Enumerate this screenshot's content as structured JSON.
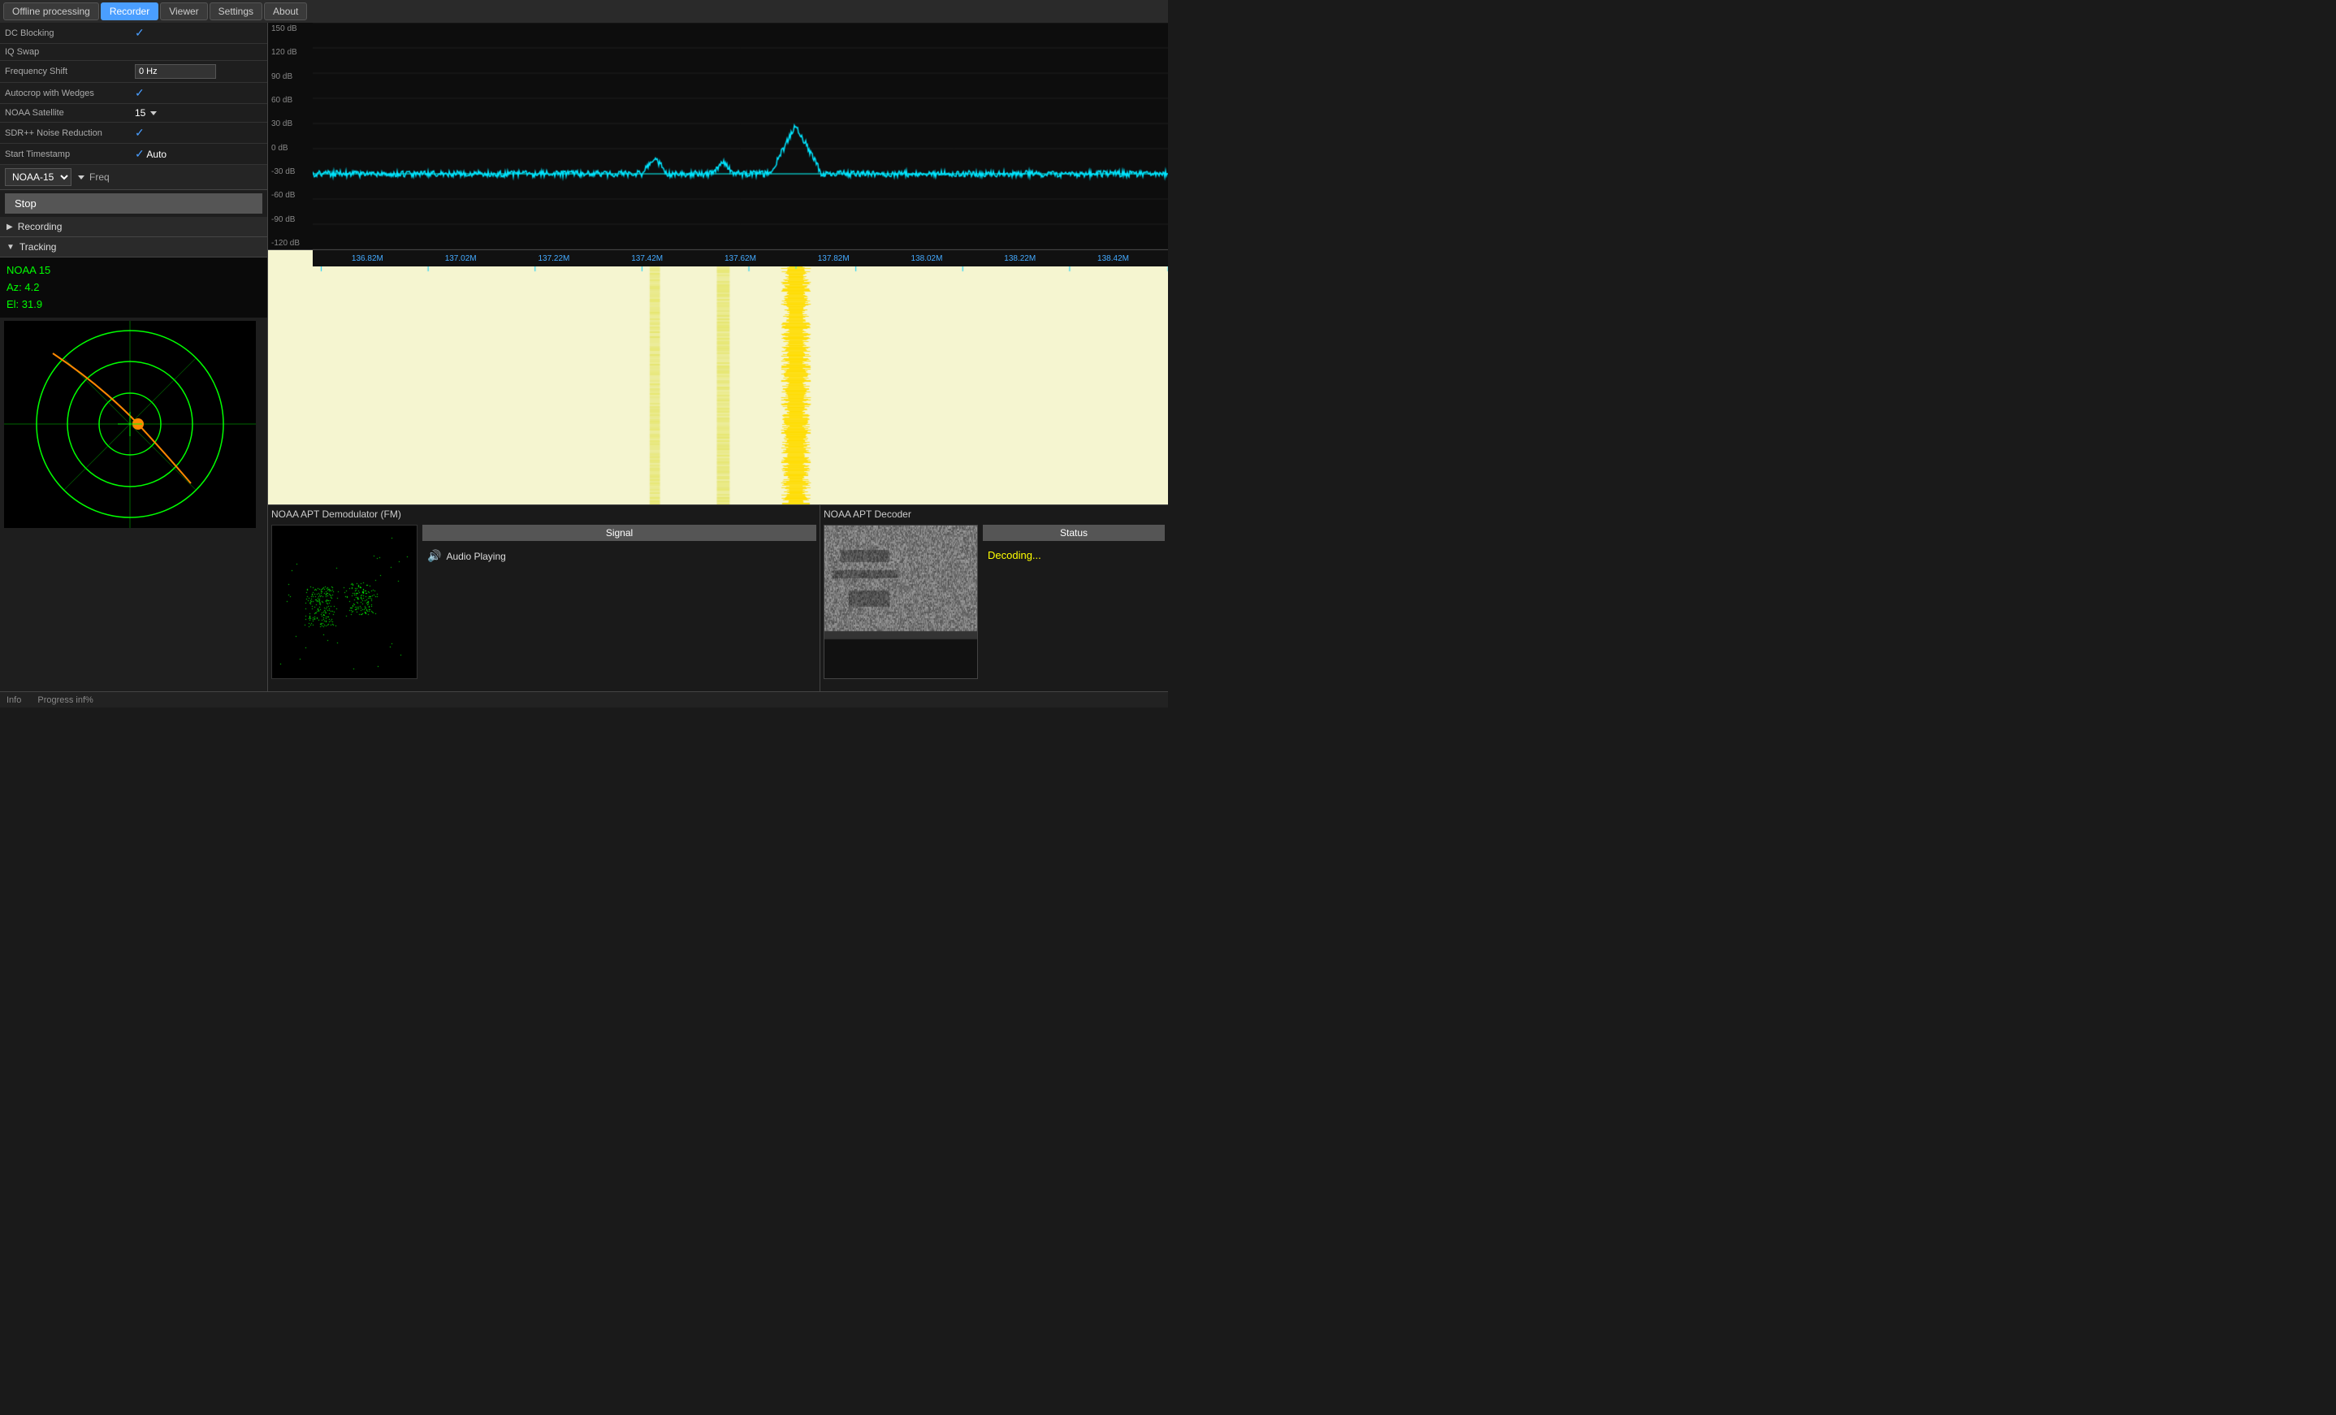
{
  "nav": {
    "tabs": [
      {
        "id": "offline",
        "label": "Offline processing",
        "active": false
      },
      {
        "id": "recorder",
        "label": "Recorder",
        "active": true
      },
      {
        "id": "viewer",
        "label": "Viewer",
        "active": false
      },
      {
        "id": "settings",
        "label": "Settings",
        "active": false
      },
      {
        "id": "about",
        "label": "About",
        "active": false
      }
    ]
  },
  "settings": {
    "rows": [
      {
        "label": "DC Blocking",
        "value": "✓",
        "type": "check"
      },
      {
        "label": "IQ Swap",
        "value": "",
        "type": "check-empty"
      },
      {
        "label": "Frequency Shift",
        "value": "0 Hz",
        "type": "input"
      },
      {
        "label": "Autocrop with Wedges",
        "value": "✓",
        "type": "check"
      },
      {
        "label": "NOAA Satellite",
        "value": "15",
        "type": "dropdown"
      },
      {
        "label": "SDR++ Noise Reduction",
        "value": "✓",
        "type": "check"
      },
      {
        "label": "Start Timestamp",
        "value": "Auto",
        "type": "check-text"
      }
    ]
  },
  "satellite_selector": {
    "name": "NOAA-15",
    "freq_label": "Freq"
  },
  "controls": {
    "stop_label": "Stop",
    "recording_label": "Recording",
    "tracking_label": "Tracking"
  },
  "tracking_info": {
    "name": "NOAA 15",
    "az_label": "Az:",
    "az_value": "4.2",
    "el_label": "El:",
    "el_value": "31.9"
  },
  "spectrum": {
    "db_labels": [
      "150 dB",
      "120 dB",
      "90 dB",
      "60 dB",
      "30 dB",
      "0 dB",
      "-30 dB",
      "-60 dB",
      "-90 dB",
      "-120 dB"
    ],
    "freq_labels": [
      "136.82M",
      "137.02M",
      "137.22M",
      "137.42M",
      "137.62M",
      "137.82M",
      "138.02M",
      "138.22M",
      "138.42M"
    ]
  },
  "demodulator": {
    "title": "NOAA APT Demodulator (FM)",
    "signal_label": "Signal",
    "audio_playing": "Audio Playing"
  },
  "decoder": {
    "title": "NOAA APT Decoder",
    "status_label": "Status",
    "status_text": "Decoding..."
  },
  "status_bar": {
    "info_label": "Info",
    "progress_label": "Progress inf%"
  }
}
